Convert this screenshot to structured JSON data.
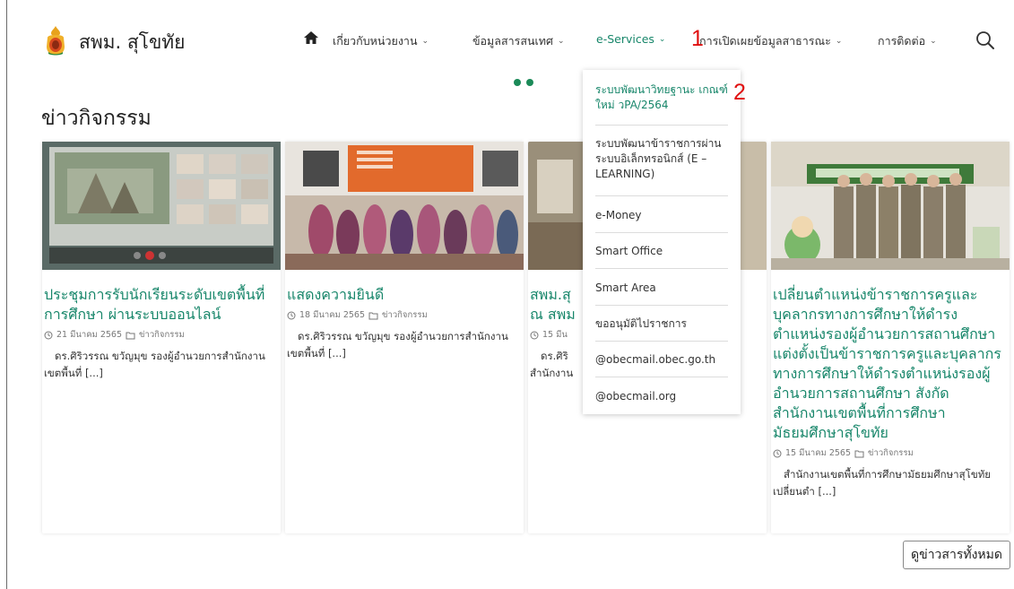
{
  "site": {
    "name": "สพม. สุโขทัย"
  },
  "nav": {
    "items": [
      {
        "label": "เกี่ยวกับหน่วยงาน",
        "chev": "⌄"
      },
      {
        "label": "ข้อมูลสารสนเทศ",
        "chev": "⌄"
      },
      {
        "label": "e-Services",
        "chev": "⌄"
      },
      {
        "label": "การเปิดเผยข้อมูลสาธารณะ",
        "chev": "⌄"
      },
      {
        "label": "การติดต่อ",
        "chev": "⌄"
      }
    ],
    "icons": {
      "home": "home-icon",
      "search": "search-icon"
    }
  },
  "annotations": [
    "1",
    "2"
  ],
  "section": {
    "title": "ข่าวกิจกรรม"
  },
  "cards": [
    {
      "title": "ประชุมการรับนักเรียนระดับเขตพื้นที่การศึกษา ผ่านระบบออนไลน์",
      "date": "21 มีนาคม 2565",
      "category": "ข่าวกิจกรรม",
      "excerpt": "ดร.ศิริวรรณ ขวัญมุข รองผู้อำนวยการสำนักงานเขตพื้นที่ [...]"
    },
    {
      "title": "แสดงความยินดี",
      "date": "18 มีนาคม 2565",
      "category": "ข่าวกิจกรรม",
      "excerpt": "ดร.ศิริวรรณ ขวัญมุข รองผู้อำนวยการสำนักงานเขตพื้นที่ [...]"
    },
    {
      "title": "สพม.สุ ณ สพม",
      "date": "15 มีน",
      "category": "",
      "excerpt": "ดร.ศิริ สำนักงาน"
    },
    {
      "title": "เปลี่ยนตำแหน่งข้าราชการครูและบุคลากรทางการศึกษาให้ดำรงตำแหน่งรองผู้อำนวยการสถานศึกษา แต่งตั้งเป็นข้าราชการครูและบุคลากรทางการศึกษาให้ดำรงตำแหน่งรองผู้อำนวยการสถานศึกษา สังกัดสำนักงานเขตพื้นที่การศึกษามัธยมศึกษาสุโขทัย",
      "date": "15 มีนาคม 2565",
      "category": "ข่าวกิจกรรม",
      "excerpt": "สำนักงานเขตพื้นที่การศึกษามัธยมศึกษาสุโขทัย เปลี่ยนตำ [...]"
    }
  ],
  "dropdown": {
    "items": [
      "ระบบพัฒนาวิทยฐานะ เกณฑ์ใหม่ วPA/2564",
      "ระบบพัฒนาข้าราชการผ่านระบบอิเล็กทรอนิกส์ (E – LEARNING)",
      "e-Money",
      "Smart Office",
      "Smart Area",
      "ขออนุมัติไปราชการ",
      "@obecmail.obec.go.th",
      "@obecmail.org"
    ]
  },
  "footer": {
    "all_news_button": "ดูข่าวสารทั้งหมด"
  },
  "colors": {
    "accent": "#17866a",
    "annotation": "#e01010",
    "dot": "#1b8a58"
  }
}
